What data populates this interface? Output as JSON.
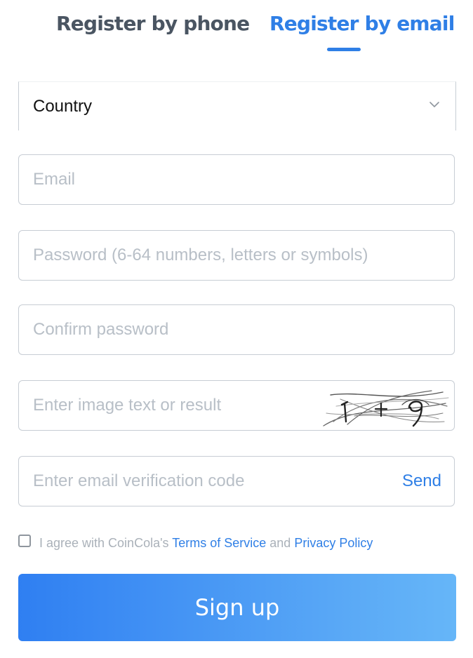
{
  "tabs": {
    "phone_label": "Register by phone",
    "email_label": "Register by email",
    "active": "email"
  },
  "form": {
    "country": {
      "value": "Country"
    },
    "email": {
      "placeholder": "Email",
      "value": ""
    },
    "password": {
      "placeholder": "Password (6-64 numbers, letters or symbols)",
      "value": ""
    },
    "confirm_password": {
      "placeholder": "Confirm password",
      "value": ""
    },
    "image_code": {
      "placeholder": "Enter image text or result",
      "value": ""
    },
    "email_code": {
      "placeholder": "Enter email verification code",
      "value": "",
      "send_label": "Send"
    }
  },
  "agreement": {
    "checked": false,
    "prefix": "I agree with CoinCola's",
    "terms_label": "Terms of Service",
    "conjunction": "and",
    "privacy_label": "Privacy Policy"
  },
  "signup_label": "Sign up",
  "icons": {
    "country_dropdown": "chevron-down-icon",
    "captcha": "captcha-image"
  },
  "colors": {
    "accent": "#2f7fe6",
    "inactive_tab": "#4a5562",
    "border": "#c7cdd4",
    "placeholder": "#b8bfc7"
  }
}
